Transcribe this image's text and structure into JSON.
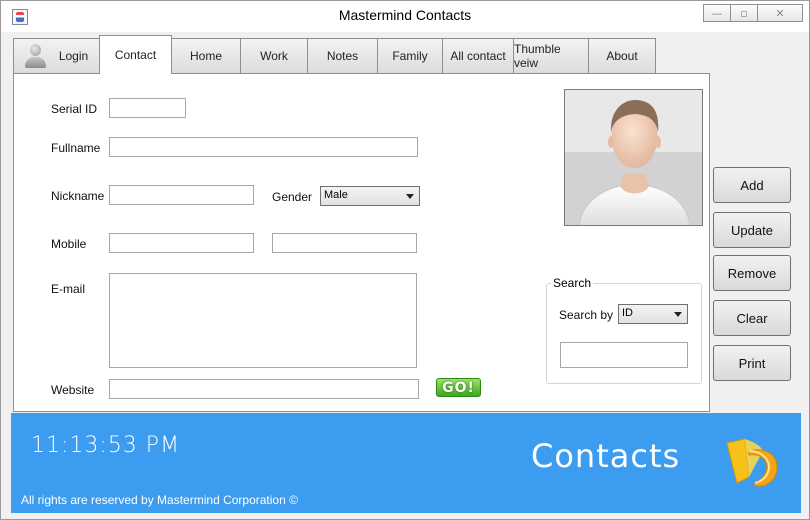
{
  "window": {
    "title": "Mastermind Contacts",
    "controls": {
      "minimize": "—",
      "restore": "▫",
      "close": "✕"
    }
  },
  "tabs": [
    {
      "label": "Login",
      "icon": "user-icon",
      "active": false
    },
    {
      "label": "Contact",
      "active": true
    },
    {
      "label": "Home",
      "active": false
    },
    {
      "label": "Work",
      "active": false
    },
    {
      "label": "Notes",
      "active": false
    },
    {
      "label": "Family",
      "active": false
    },
    {
      "label": "All contact",
      "active": false
    },
    {
      "label": "Thumble veiw",
      "active": false
    },
    {
      "label": "About",
      "active": false
    }
  ],
  "form": {
    "serial_label": "Serial ID",
    "serial_value": "",
    "fullname_label": "Fullname",
    "fullname_value": "",
    "nickname_label": "Nickname",
    "nickname_value": "",
    "gender_label": "Gender",
    "gender_value": "Male",
    "mobile_label": "Mobile",
    "mobile_value": "",
    "mobile2_value": "",
    "email_label": "E-mail",
    "email_value": "",
    "website_label": "Website",
    "website_value": "",
    "go_label": "GO!"
  },
  "search": {
    "legend": "Search",
    "by_label": "Search by",
    "by_value": "ID",
    "query_value": ""
  },
  "actions": {
    "add": "Add",
    "update": "Update",
    "remove": "Remove",
    "clear": "Clear",
    "print": "Print"
  },
  "footer": {
    "time": "11:13:53 PM",
    "brand": "Contacts",
    "copyright": "All rights are reserved by Mastermind Corporation ©",
    "background": "#3b9cf0",
    "logo": "contacts-logo-icon"
  }
}
